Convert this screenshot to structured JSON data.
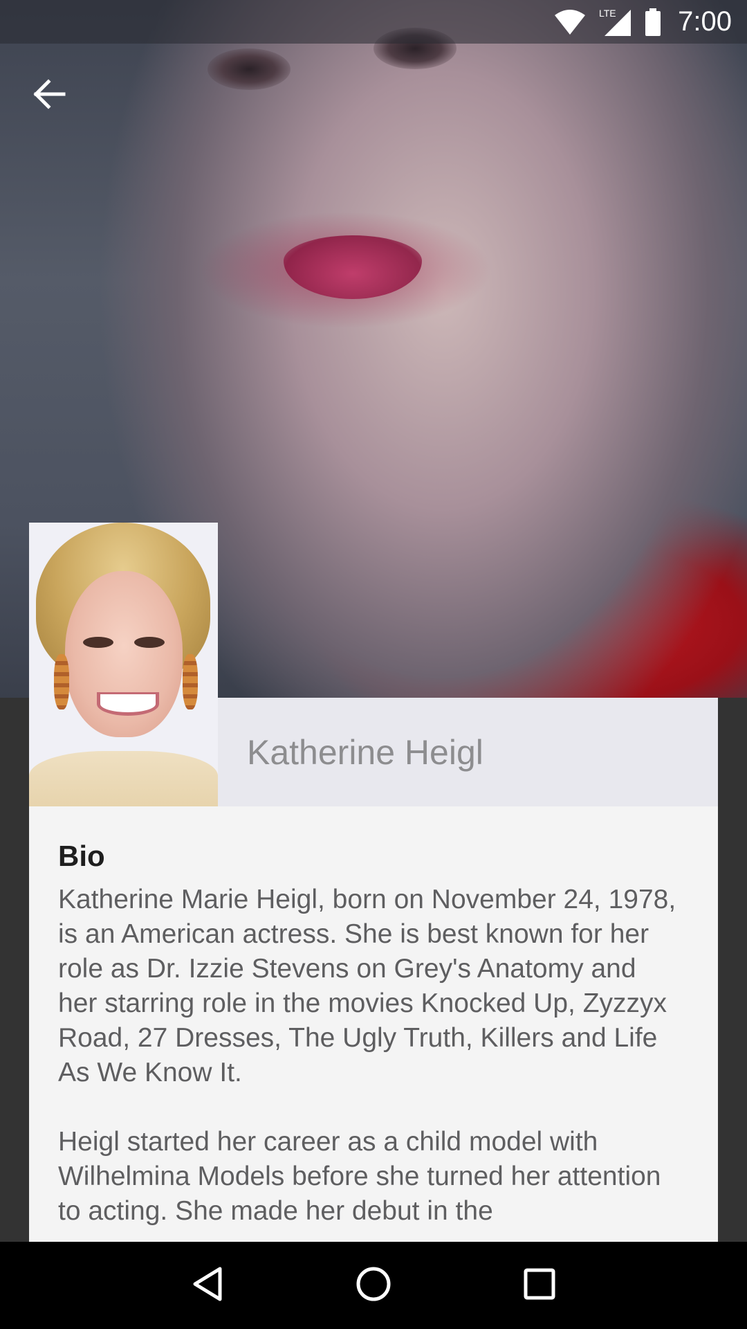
{
  "status_bar": {
    "time": "7:00",
    "network_label": "LTE",
    "icons": [
      "wifi-icon",
      "cellular-signal-icon",
      "battery-icon"
    ]
  },
  "header": {
    "back_icon": "arrow-left-icon"
  },
  "profile": {
    "name": "Katherine Heigl"
  },
  "bio": {
    "title": "Bio",
    "paragraphs": [
      "Katherine Marie Heigl, born on November 24, 1978, is an American actress. She is best known for her role as Dr. Izzie Stevens on Grey's Anatomy and her starring role in the movies Knocked Up, Zyzzyx Road, 27 Dresses, The Ugly Truth, Killers and Life As We Know It.",
      "Heigl started her career as a child model with Wilhelmina Models before she turned her attention to acting. She made her debut in the"
    ]
  },
  "nav_bar": {
    "icons": [
      "back-triangle-icon",
      "home-circle-icon",
      "recents-square-icon"
    ]
  },
  "colors": {
    "card_background": "#f4f4f4",
    "name_strip": "#e8e8ee",
    "name_text": "#8d8d8f",
    "bio_text": "#5e5e60",
    "side_background": "#333333"
  }
}
